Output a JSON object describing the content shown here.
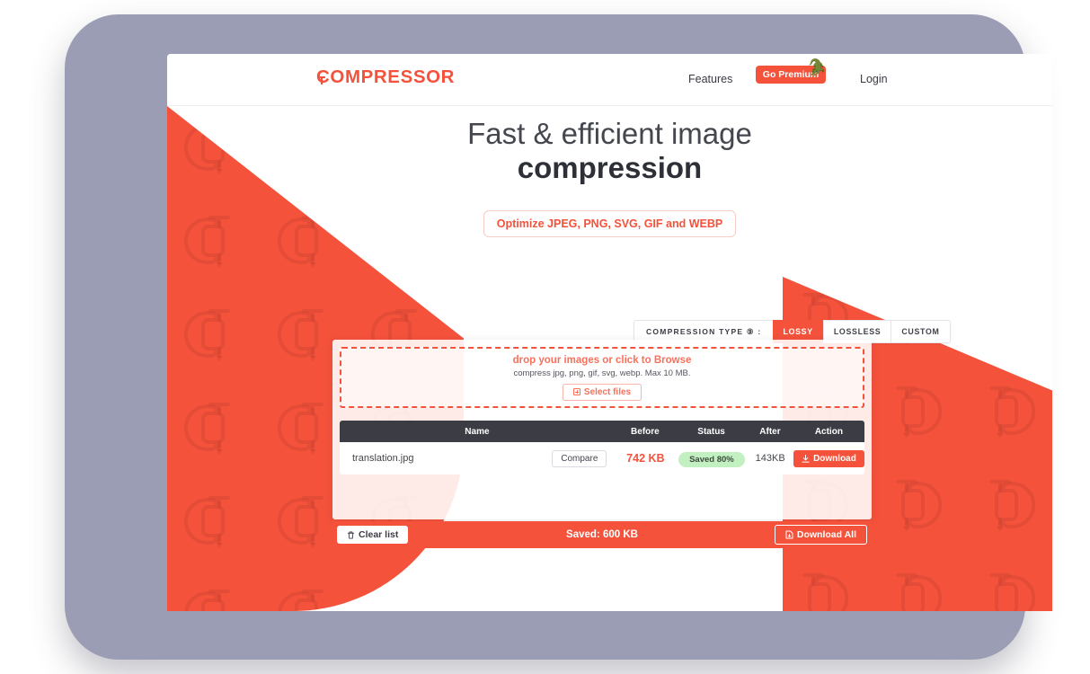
{
  "header": {
    "logo": "COMPRESSOR",
    "logo_icon": "clamp-icon",
    "nav": {
      "features": "Features",
      "premium": "Go Premium",
      "premium_icon": "crocodile-icon",
      "login": "Login"
    }
  },
  "hero": {
    "line1": "Fast & efficient image",
    "line2": "compression",
    "badge": "Optimize JPEG, PNG, SVG, GIF and WEBP"
  },
  "compression_type": {
    "label": "COMPRESSION TYPE ⑨ :",
    "help_icon": "question-mark-icon",
    "options": [
      {
        "label": "LOSSY",
        "active": true
      },
      {
        "label": "LOSSLESS",
        "active": false
      },
      {
        "label": "CUSTOM",
        "active": false
      }
    ]
  },
  "dropzone": {
    "title": "drop your images or click to Browse",
    "subtitle": "compress jpg, png, gif, svg, webp. Max 10 MB.",
    "select_button": "Select files",
    "select_icon": "plus-square-icon"
  },
  "table": {
    "headers": {
      "name": "Name",
      "before": "Before",
      "status": "Status",
      "after": "After",
      "action": "Action"
    },
    "rows": [
      {
        "name": "translation.jpg",
        "compare": "Compare",
        "before": "742 KB",
        "status": "Saved 80%",
        "after": "143KB",
        "action": "Download",
        "action_icon": "download-icon"
      }
    ]
  },
  "footer": {
    "clear_list": "Clear list",
    "clear_icon": "trash-icon",
    "saved_total": "Saved: 600 KB",
    "download_all": "Download All",
    "download_all_icon": "file-download-icon"
  },
  "colors": {
    "brand_red": "#f4523b",
    "brand_red_light": "#f9705c",
    "dark_header": "#3c3d44",
    "status_green_bg": "#c3f0c0",
    "frame_gray": "#9a9db4"
  }
}
